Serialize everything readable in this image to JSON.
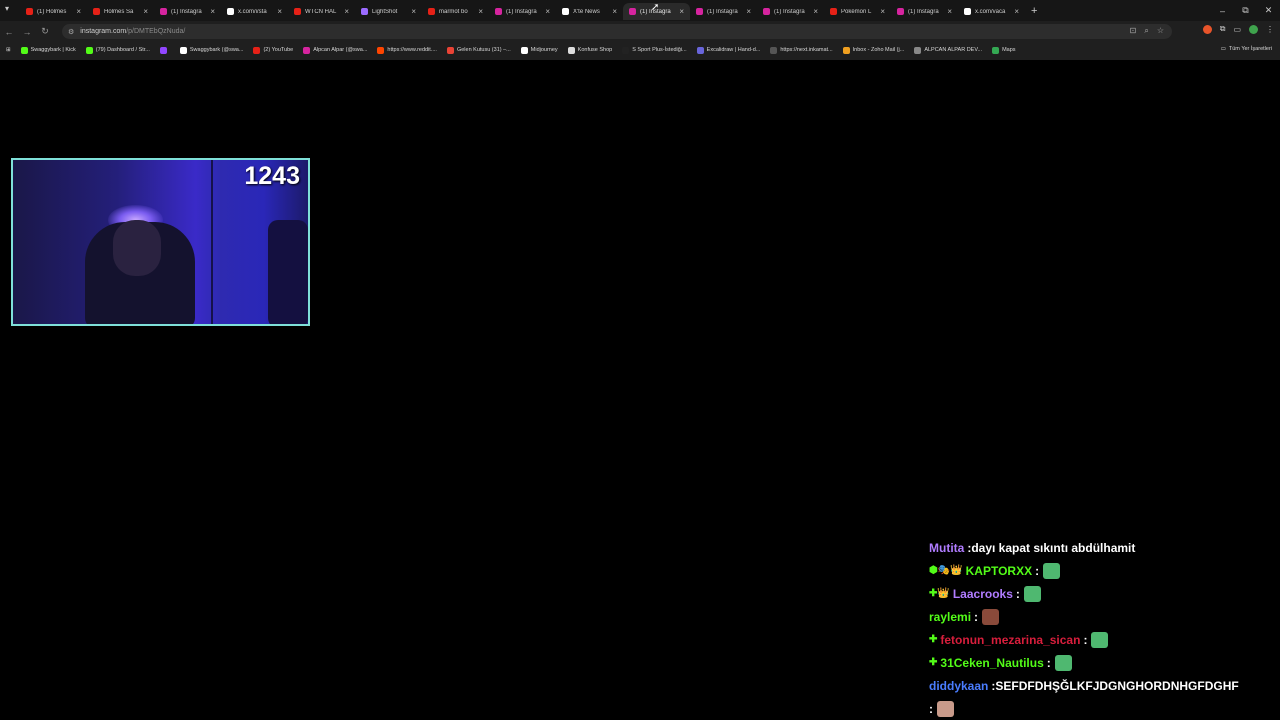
{
  "browser": {
    "tabs": [
      {
        "title": "(1) Holmes",
        "color": "#e62117",
        "active": false
      },
      {
        "title": "Holmes Sa",
        "color": "#e62117",
        "active": false
      },
      {
        "title": "(1) Instagra",
        "color": "#d6249f",
        "active": false
      },
      {
        "title": "x.com/i/sta",
        "color": "#ffffff",
        "active": false
      },
      {
        "title": "WTCN HAL",
        "color": "#e62117",
        "active": false
      },
      {
        "title": "LightShot",
        "color": "#9b6bff",
        "active": false
      },
      {
        "title": "marmot bo",
        "color": "#e62117",
        "active": false
      },
      {
        "title": "(1) Instagra",
        "color": "#d6249f",
        "active": false
      },
      {
        "title": "X'te News",
        "color": "#ffffff",
        "active": false
      },
      {
        "title": "(1) Instagra",
        "color": "#d6249f",
        "active": true
      },
      {
        "title": "(1) Instagra",
        "color": "#d6249f",
        "active": false
      },
      {
        "title": "(1) Instagra",
        "color": "#d6249f",
        "active": false
      },
      {
        "title": "Pokémon L",
        "color": "#e62117",
        "active": false
      },
      {
        "title": "(1) Instagra",
        "color": "#d6249f",
        "active": false
      },
      {
        "title": "x.com/vaca",
        "color": "#ffffff",
        "active": false
      }
    ],
    "address": {
      "host": "instagram.com",
      "path": "/p/DMTEbQzNuda/"
    },
    "bookmarks": [
      {
        "label": "Swaggybark | Kick",
        "color": "#53fc18"
      },
      {
        "label": "(79) Dashboard / Str...",
        "color": "#53fc18"
      },
      {
        "label": "",
        "color": "#9146ff"
      },
      {
        "label": "Swaggybark (@swa...",
        "color": "#ffffff"
      },
      {
        "label": "(2) YouTube",
        "color": "#e62117"
      },
      {
        "label": "Alpcan Alpar (@swa...",
        "color": "#d6249f"
      },
      {
        "label": "https://www.reddit....",
        "color": "#ff4500"
      },
      {
        "label": "Gelen Kutusu (31) –...",
        "color": "#ea4335"
      },
      {
        "label": "Midjourney",
        "color": "#ffffff"
      },
      {
        "label": "Konfuse Shop",
        "color": "#dddddd"
      },
      {
        "label": "S Sport Plus-İstediği...",
        "color": "#222222"
      },
      {
        "label": "Excalidraw | Hand-d...",
        "color": "#6965db"
      },
      {
        "label": "https://next.inkamat...",
        "color": "#555555"
      },
      {
        "label": "Inbox - Zoho Mail (j...",
        "color": "#f0a020"
      },
      {
        "label": "ALPCAN ALPAR DEV...",
        "color": "#888888"
      },
      {
        "label": "Maps",
        "color": "#34a853"
      }
    ],
    "all_bookmarks_label": "Tüm Yer İşaretleri"
  },
  "webcam": {
    "counter": "1243"
  },
  "chat": [
    {
      "badges": "",
      "user": "Mutita",
      "user_color": "#b07cff",
      "text": "dayı kapat sıkıntı abdülhamit",
      "emote": ""
    },
    {
      "badges": "⬢🎭👑",
      "user": "KAPTORXX",
      "user_color": "#53fc18",
      "text": "",
      "emote": "#4fb870"
    },
    {
      "badges": "✚👑",
      "user": "Laacrooks",
      "user_color": "#b07cff",
      "text": "",
      "emote": "#4fb870"
    },
    {
      "badges": "",
      "user": "raylemi",
      "user_color": "#53fc18",
      "text": "",
      "emote": "#8a4a3a"
    },
    {
      "badges": "✚",
      "user": "fetonun_mezarina_sican",
      "user_color": "#d81e3c",
      "text": "",
      "emote": "#4fb870"
    },
    {
      "badges": "✚",
      "user": "31Ceken_Nautilus",
      "user_color": "#53fc18",
      "text": "",
      "emote": "#4fb870"
    },
    {
      "badges": "",
      "user": "diddykaan",
      "user_color": "#4a7dff",
      "text": "SEFDFDHŞĞLKFJDGNGHORDNHGFDGHF",
      "emote": ""
    },
    {
      "badges": "",
      "user": "",
      "user_color": "#ffffff",
      "text": "",
      "emote": "#c89a8a"
    }
  ]
}
